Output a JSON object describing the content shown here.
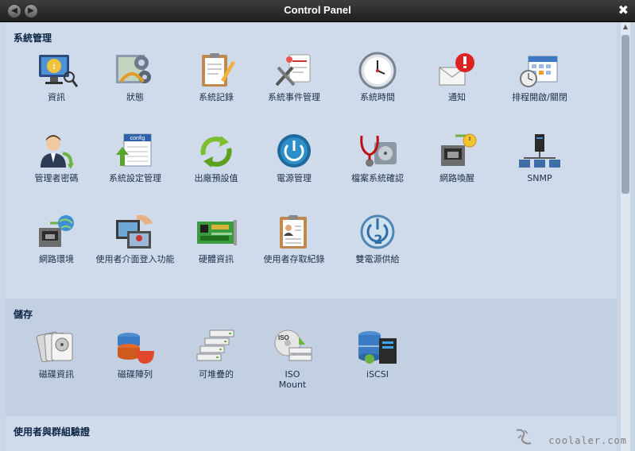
{
  "window": {
    "title": "Control Panel",
    "close": "✖",
    "back": "◀",
    "forward": "▶"
  },
  "sections": [
    {
      "title": "系統管理",
      "items": [
        {
          "label": "資訊",
          "icon": "info-monitor-icon"
        },
        {
          "label": "狀態",
          "icon": "status-gears-icon"
        },
        {
          "label": "系統記錄",
          "icon": "system-log-clipboard-icon"
        },
        {
          "label": "系統事件管理",
          "icon": "system-event-tools-icon"
        },
        {
          "label": "系統時間",
          "icon": "clock-icon"
        },
        {
          "label": "通知",
          "icon": "notification-envelope-icon"
        },
        {
          "label": "排程開啟/關閉",
          "icon": "schedule-calendar-icon"
        },
        {
          "label": "管理者密碼",
          "icon": "admin-user-icon"
        },
        {
          "label": "系統設定管理",
          "icon": "config-file-icon"
        },
        {
          "label": "出廠預設值",
          "icon": "factory-reset-arrows-icon"
        },
        {
          "label": "電源管理",
          "icon": "power-button-icon"
        },
        {
          "label": "檔案系統確認",
          "icon": "filesystem-check-stethoscope-icon"
        },
        {
          "label": "網路喚醒",
          "icon": "wake-on-lan-icon"
        },
        {
          "label": "SNMP",
          "icon": "snmp-network-icon"
        },
        {
          "label": "網路環境",
          "icon": "network-environment-globe-icon"
        },
        {
          "label": "使用者介面登入功能",
          "icon": "ui-login-hand-icon"
        },
        {
          "label": "硬體資訊",
          "icon": "hardware-board-icon"
        },
        {
          "label": "使用者存取紀錄",
          "icon": "user-access-log-icon"
        },
        {
          "label": "雙電源供給",
          "icon": "dual-power-icon"
        }
      ]
    },
    {
      "title": "儲存",
      "items": [
        {
          "label": "磁碟資訊",
          "icon": "disk-info-icon"
        },
        {
          "label": "磁碟陣列",
          "icon": "raid-icon"
        },
        {
          "label": "可堆疊的",
          "icon": "stackable-servers-icon"
        },
        {
          "label": "ISO Mount",
          "icon": "iso-mount-icon"
        },
        {
          "label": "iSCSI",
          "icon": "iscsi-icon"
        }
      ]
    },
    {
      "title": "使用者與群組驗證",
      "items": []
    }
  ],
  "watermark": {
    "text": "coolaler.com"
  },
  "colors": {
    "titlebar": "#2a2a2a",
    "section_a": "#cfdbeb",
    "section_b": "#c2d0e2",
    "label": "#1c2f4a"
  }
}
